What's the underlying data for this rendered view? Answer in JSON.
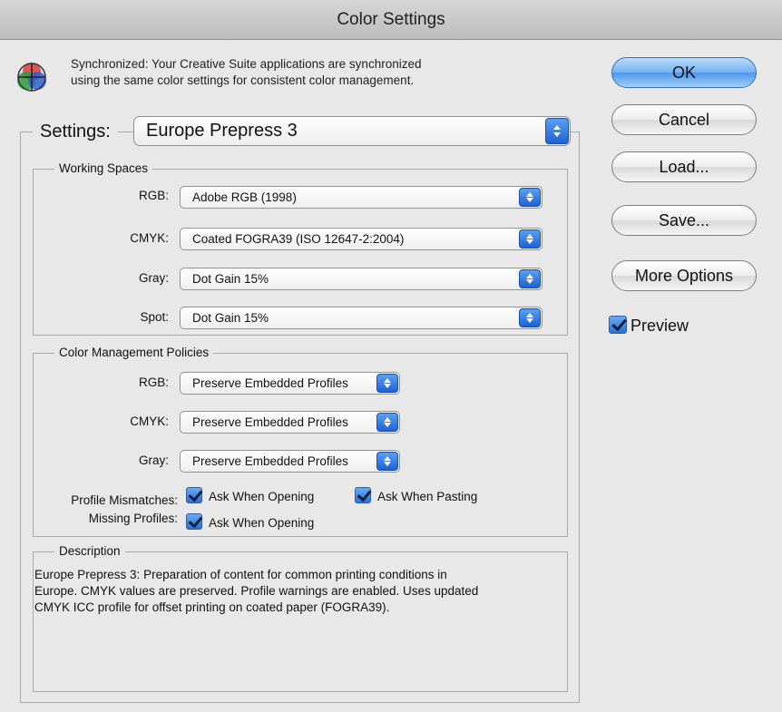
{
  "window": {
    "title": "Color Settings"
  },
  "sync": {
    "icon": "color-wheel-icon",
    "line1": "Synchronized: Your Creative Suite applications are synchronized",
    "line2": "using the same color settings for consistent color management."
  },
  "settings": {
    "label": "Settings:",
    "value": "Europe Prepress 3"
  },
  "working_spaces": {
    "title": "Working Spaces",
    "rows": [
      {
        "label": "RGB:",
        "value": "Adobe RGB (1998)"
      },
      {
        "label": "CMYK:",
        "value": "Coated FOGRA39 (ISO 12647-2:2004)"
      },
      {
        "label": "Gray:",
        "value": "Dot Gain 15%"
      },
      {
        "label": "Spot:",
        "value": "Dot Gain 15%"
      }
    ]
  },
  "policies": {
    "title": "Color Management Policies",
    "rows": [
      {
        "label": "RGB:",
        "value": "Preserve Embedded Profiles"
      },
      {
        "label": "CMYK:",
        "value": "Preserve Embedded Profiles"
      },
      {
        "label": "Gray:",
        "value": "Preserve Embedded Profiles"
      }
    ],
    "profile_mismatches": {
      "label": "Profile Mismatches:",
      "opening": {
        "label": "Ask When Opening",
        "checked": true
      },
      "pasting": {
        "label": "Ask When Pasting",
        "checked": true
      }
    },
    "missing_profiles": {
      "label": "Missing Profiles:",
      "opening": {
        "label": "Ask When Opening",
        "checked": true
      }
    }
  },
  "description": {
    "title": "Description",
    "line1": "Europe Prepress 3:  Preparation of content for common printing conditions in",
    "line2": "Europe. CMYK values are preserved. Profile warnings are enabled. Uses updated",
    "line3": "CMYK ICC profile for offset printing on coated paper (FOGRA39)."
  },
  "buttons": {
    "ok": "OK",
    "cancel": "Cancel",
    "load": "Load...",
    "save": "Save...",
    "more_options": "More Options"
  },
  "preview": {
    "label": "Preview",
    "checked": true
  },
  "colors": {
    "accent": "#2a6fd8",
    "window_bg": "#e8e8e8",
    "ok_button": "#6aaef2"
  }
}
